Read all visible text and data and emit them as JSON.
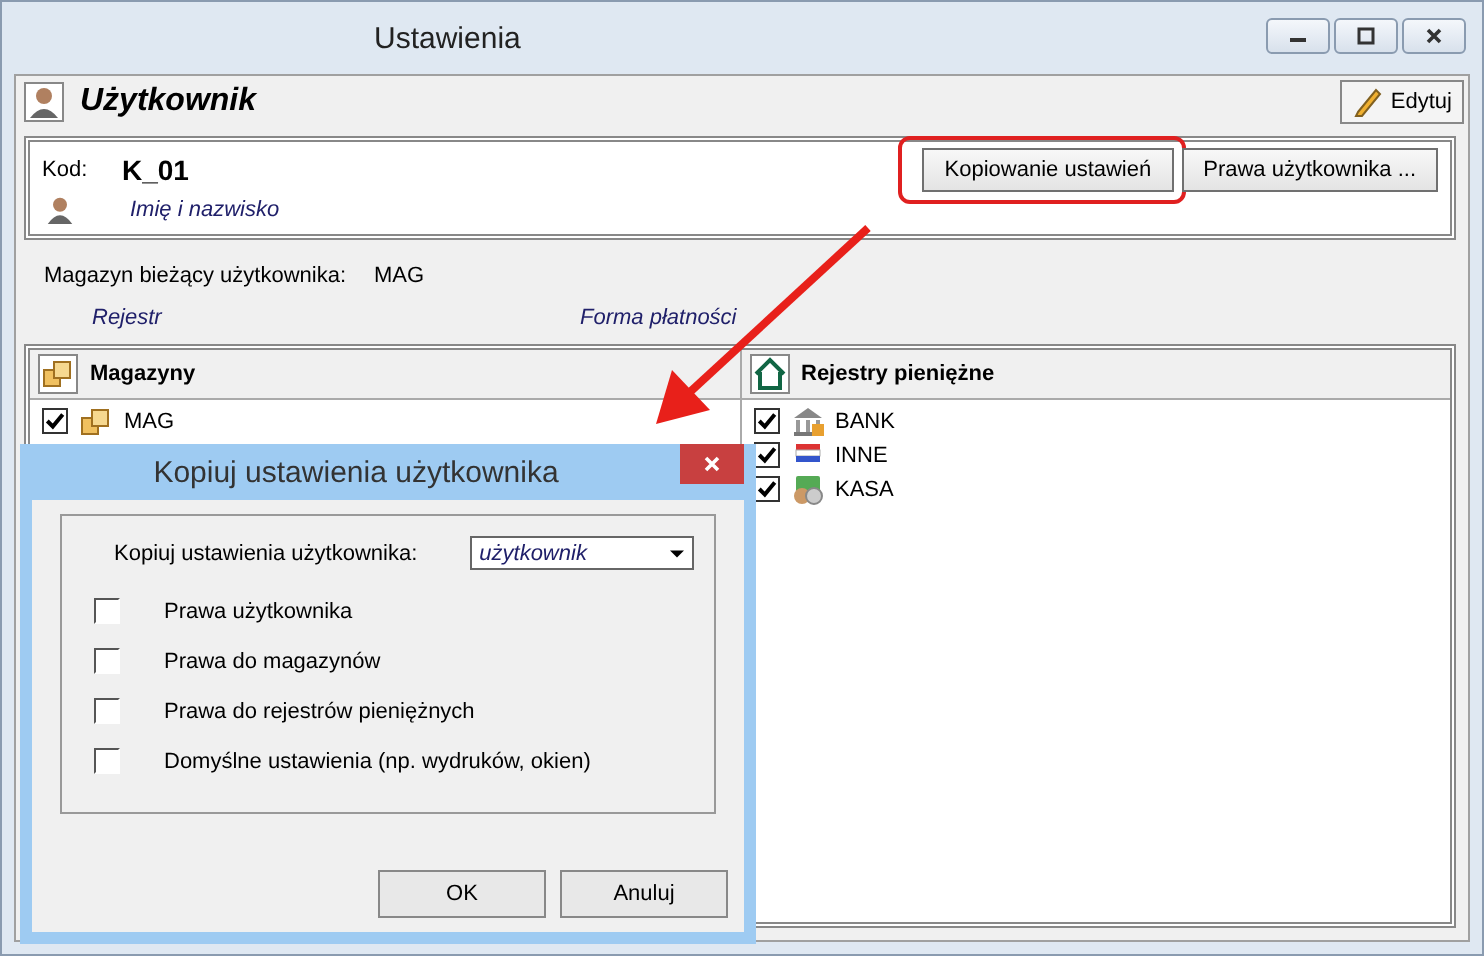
{
  "window": {
    "title": "Ustawienia"
  },
  "header": {
    "title": "Użytkownik",
    "edit_button": "Edytuj"
  },
  "user": {
    "code_label": "Kod:",
    "code": "K_01",
    "name_placeholder": "Imię i nazwisko",
    "buttons": [
      {
        "label": "Kopiowanie ustawień",
        "highlighted": true
      },
      {
        "label": "Prawa użytkownika ...",
        "highlighted": false
      }
    ]
  },
  "current_warehouse": {
    "label": "Magazyn bieżący użytkownika:",
    "value": "MAG"
  },
  "fields": [
    {
      "placeholder": "Rejestr"
    },
    {
      "placeholder": "Forma płatności"
    }
  ],
  "warehouses": {
    "title": "Magazyny",
    "items": [
      {
        "label": "MAG",
        "checked": true,
        "kind": "boxes"
      }
    ]
  },
  "registers": {
    "title": "Rejestry pieniężne",
    "items": [
      {
        "label": "BANK",
        "checked": true,
        "kind": "bank"
      },
      {
        "label": "INNE",
        "checked": true,
        "kind": "flag"
      },
      {
        "label": "KASA",
        "checked": true,
        "kind": "coins"
      }
    ]
  },
  "dialog": {
    "title": "Kopiuj ustawienia użytkownika",
    "source_label": "Kopiuj ustawienia użytkownika:",
    "source_value": "użytkownik",
    "options": [
      {
        "label": "Prawa użytkownika",
        "checked": false
      },
      {
        "label": "Prawa do magazynów",
        "checked": false
      },
      {
        "label": "Prawa do rejestrów pieniężnych",
        "checked": false
      },
      {
        "label": "Domyślne ustawienia (np. wydruków, okien)",
        "checked": false
      }
    ],
    "buttons": [
      "OK",
      "Anuluj"
    ]
  }
}
